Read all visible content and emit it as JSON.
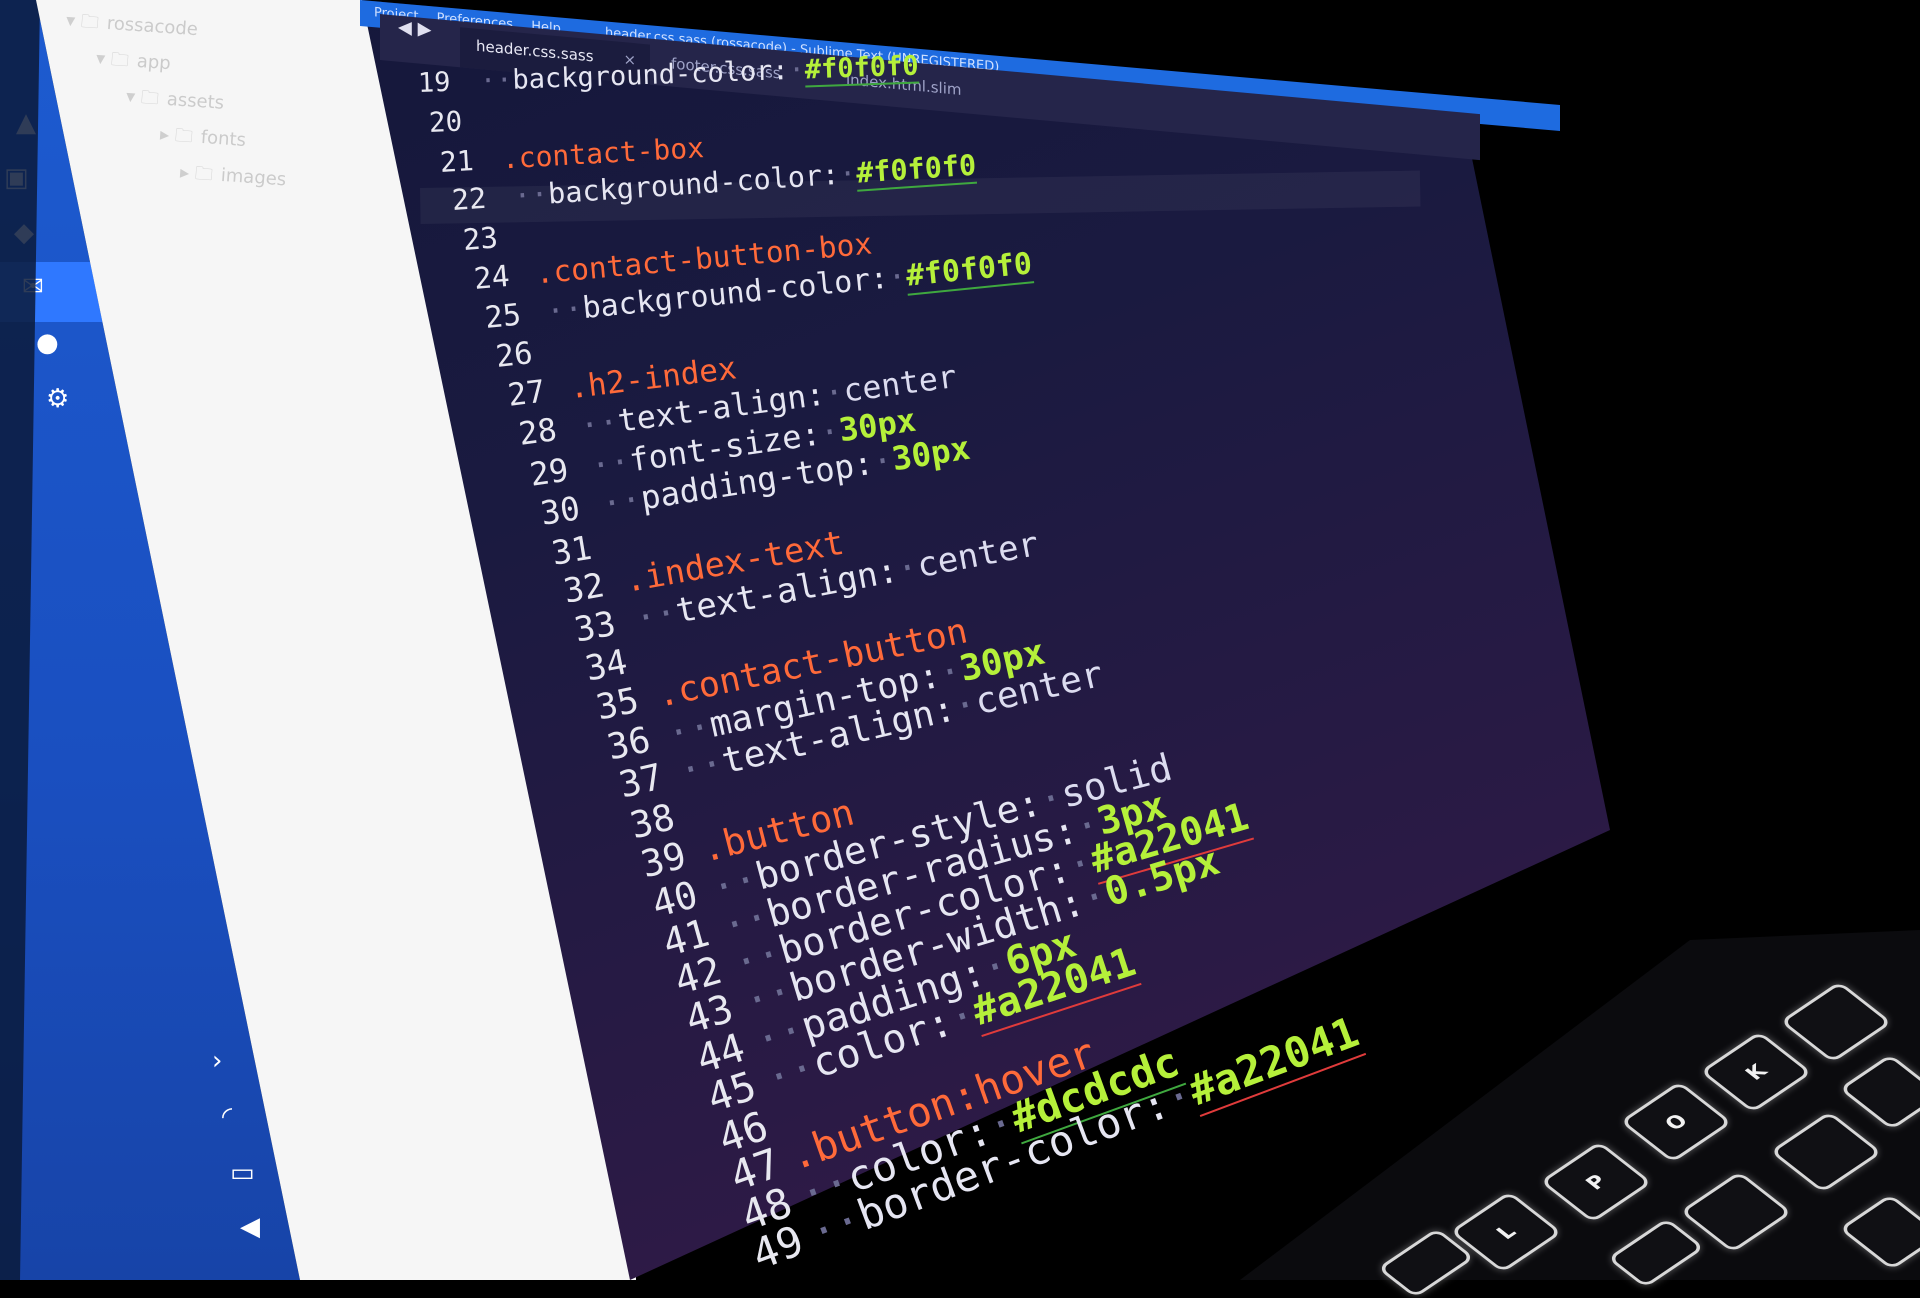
{
  "window": {
    "title": "header.css.sass (rossacode) - Sublime Text (UNREGISTERED)",
    "menu": [
      "Project",
      "Preferences",
      "Help"
    ]
  },
  "tabs": [
    {
      "label": "header.css.sass",
      "active": true
    },
    {
      "label": "footer.css.sass",
      "active": false
    },
    {
      "label": "index.html.slim",
      "active": false
    }
  ],
  "sidebar": {
    "items": [
      "rossacode",
      "app",
      "assets",
      "fonts",
      "images"
    ]
  },
  "code": [
    {
      "n": "19",
      "indent": true,
      "tokens": [
        {
          "t": "prop",
          "v": "background-color:"
        },
        {
          "t": "hex",
          "v": "#f0f0f0"
        }
      ]
    },
    {
      "n": "20",
      "indent": false,
      "tokens": []
    },
    {
      "n": "21",
      "indent": false,
      "tokens": [
        {
          "t": "sel",
          "v": ".contact-box"
        }
      ]
    },
    {
      "n": "22",
      "indent": true,
      "tokens": [
        {
          "t": "prop",
          "v": "background-color:"
        },
        {
          "t": "hex",
          "v": "#f0f0f0"
        }
      ]
    },
    {
      "n": "23",
      "indent": false,
      "tokens": []
    },
    {
      "n": "24",
      "indent": false,
      "tokens": [
        {
          "t": "sel",
          "v": ".contact-button-box"
        }
      ]
    },
    {
      "n": "25",
      "indent": true,
      "tokens": [
        {
          "t": "prop",
          "v": "background-color:"
        },
        {
          "t": "hex",
          "v": "#f0f0f0"
        }
      ]
    },
    {
      "n": "26",
      "indent": false,
      "tokens": []
    },
    {
      "n": "27",
      "indent": false,
      "tokens": [
        {
          "t": "sel",
          "v": ".h2-index"
        }
      ]
    },
    {
      "n": "28",
      "indent": true,
      "tokens": [
        {
          "t": "prop",
          "v": "text-align:"
        },
        {
          "t": "val",
          "v": "center"
        }
      ]
    },
    {
      "n": "29",
      "indent": true,
      "tokens": [
        {
          "t": "prop",
          "v": "font-size:"
        },
        {
          "t": "num",
          "v": "30px"
        }
      ]
    },
    {
      "n": "30",
      "indent": true,
      "tokens": [
        {
          "t": "prop",
          "v": "padding-top:"
        },
        {
          "t": "num",
          "v": "30px"
        }
      ]
    },
    {
      "n": "31",
      "indent": false,
      "tokens": []
    },
    {
      "n": "32",
      "indent": false,
      "tokens": [
        {
          "t": "sel",
          "v": ".index-text"
        }
      ]
    },
    {
      "n": "33",
      "indent": true,
      "tokens": [
        {
          "t": "prop",
          "v": "text-align:"
        },
        {
          "t": "val",
          "v": "center"
        }
      ]
    },
    {
      "n": "34",
      "indent": false,
      "tokens": []
    },
    {
      "n": "35",
      "indent": false,
      "tokens": [
        {
          "t": "sel",
          "v": ".contact-button"
        }
      ]
    },
    {
      "n": "36",
      "indent": true,
      "tokens": [
        {
          "t": "prop",
          "v": "margin-top:"
        },
        {
          "t": "num",
          "v": "30px"
        }
      ]
    },
    {
      "n": "37",
      "indent": true,
      "tokens": [
        {
          "t": "prop",
          "v": "text-align:"
        },
        {
          "t": "val",
          "v": "center"
        }
      ]
    },
    {
      "n": "38",
      "indent": false,
      "tokens": []
    },
    {
      "n": "39",
      "indent": false,
      "tokens": [
        {
          "t": "sel",
          "v": ".button"
        }
      ]
    },
    {
      "n": "40",
      "indent": true,
      "tokens": [
        {
          "t": "prop",
          "v": "border-style:"
        },
        {
          "t": "val",
          "v": "solid"
        }
      ]
    },
    {
      "n": "41",
      "indent": true,
      "tokens": [
        {
          "t": "prop",
          "v": "border-radius:"
        },
        {
          "t": "num",
          "v": "3px"
        }
      ]
    },
    {
      "n": "42",
      "indent": true,
      "tokens": [
        {
          "t": "prop",
          "v": "border-color:"
        },
        {
          "t": "hex-red",
          "v": "#a22041"
        }
      ]
    },
    {
      "n": "43",
      "indent": true,
      "tokens": [
        {
          "t": "prop",
          "v": "border-width:"
        },
        {
          "t": "num",
          "v": "0.5px"
        }
      ]
    },
    {
      "n": "44",
      "indent": true,
      "tokens": [
        {
          "t": "prop",
          "v": "padding:"
        },
        {
          "t": "num",
          "v": "6px"
        }
      ]
    },
    {
      "n": "45",
      "indent": true,
      "tokens": [
        {
          "t": "prop",
          "v": "color:"
        },
        {
          "t": "hex-red",
          "v": "#a22041"
        }
      ]
    },
    {
      "n": "46",
      "indent": false,
      "tokens": []
    },
    {
      "n": "47",
      "indent": false,
      "tokens": [
        {
          "t": "sel",
          "v": ".button:hover"
        }
      ]
    },
    {
      "n": "48",
      "indent": true,
      "tokens": [
        {
          "t": "prop",
          "v": "color:"
        },
        {
          "t": "hex",
          "v": "#dcdcdc"
        }
      ]
    },
    {
      "n": "49",
      "indent": true,
      "tokens": [
        {
          "t": "prop",
          "v": "border-color:"
        },
        {
          "t": "hex-red",
          "v": "#a22041"
        }
      ]
    }
  ],
  "keyboard": {
    "keys": [
      "P",
      "O",
      "L",
      "K"
    ]
  },
  "colors": {
    "selector": "#ff6a3a",
    "number": "#b5f03a",
    "taskbar": "#1d5bd0",
    "editor_bg": "#1a1a40"
  }
}
